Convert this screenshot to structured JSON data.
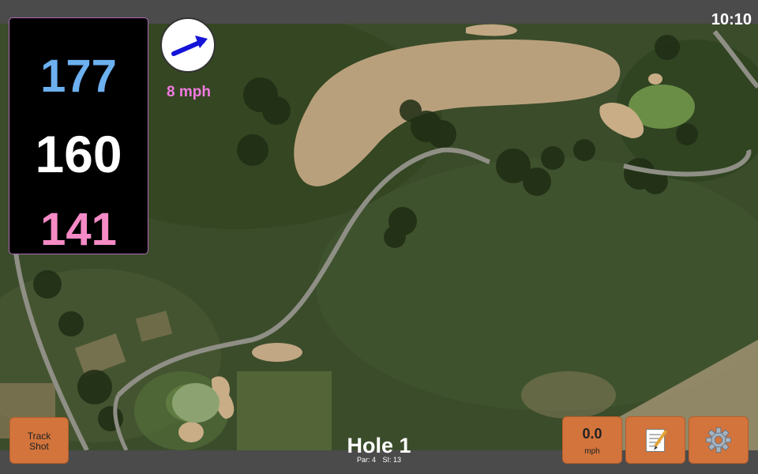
{
  "status": {
    "time": "10:10"
  },
  "distances": {
    "back": "177",
    "middle": "160",
    "front": "141"
  },
  "wind": {
    "speed_label": "8 mph",
    "arrow_icon": "wind-direction-arrow-icon"
  },
  "buttons": {
    "track_shot_label": "Track\nShot",
    "speed_value": "0.0",
    "speed_unit": "mph",
    "notes_icon": "notepad-icon",
    "settings_icon": "gear-icon"
  },
  "hole": {
    "title": "Hole 1",
    "par": "Par: 4",
    "stroke_index": "SI: 13"
  },
  "colors": {
    "back_distance": "#6cb0f0",
    "middle_distance": "#ffffff",
    "front_distance": "#f58ac6",
    "button": "#d2743c",
    "wind_text": "#f07ae0"
  }
}
